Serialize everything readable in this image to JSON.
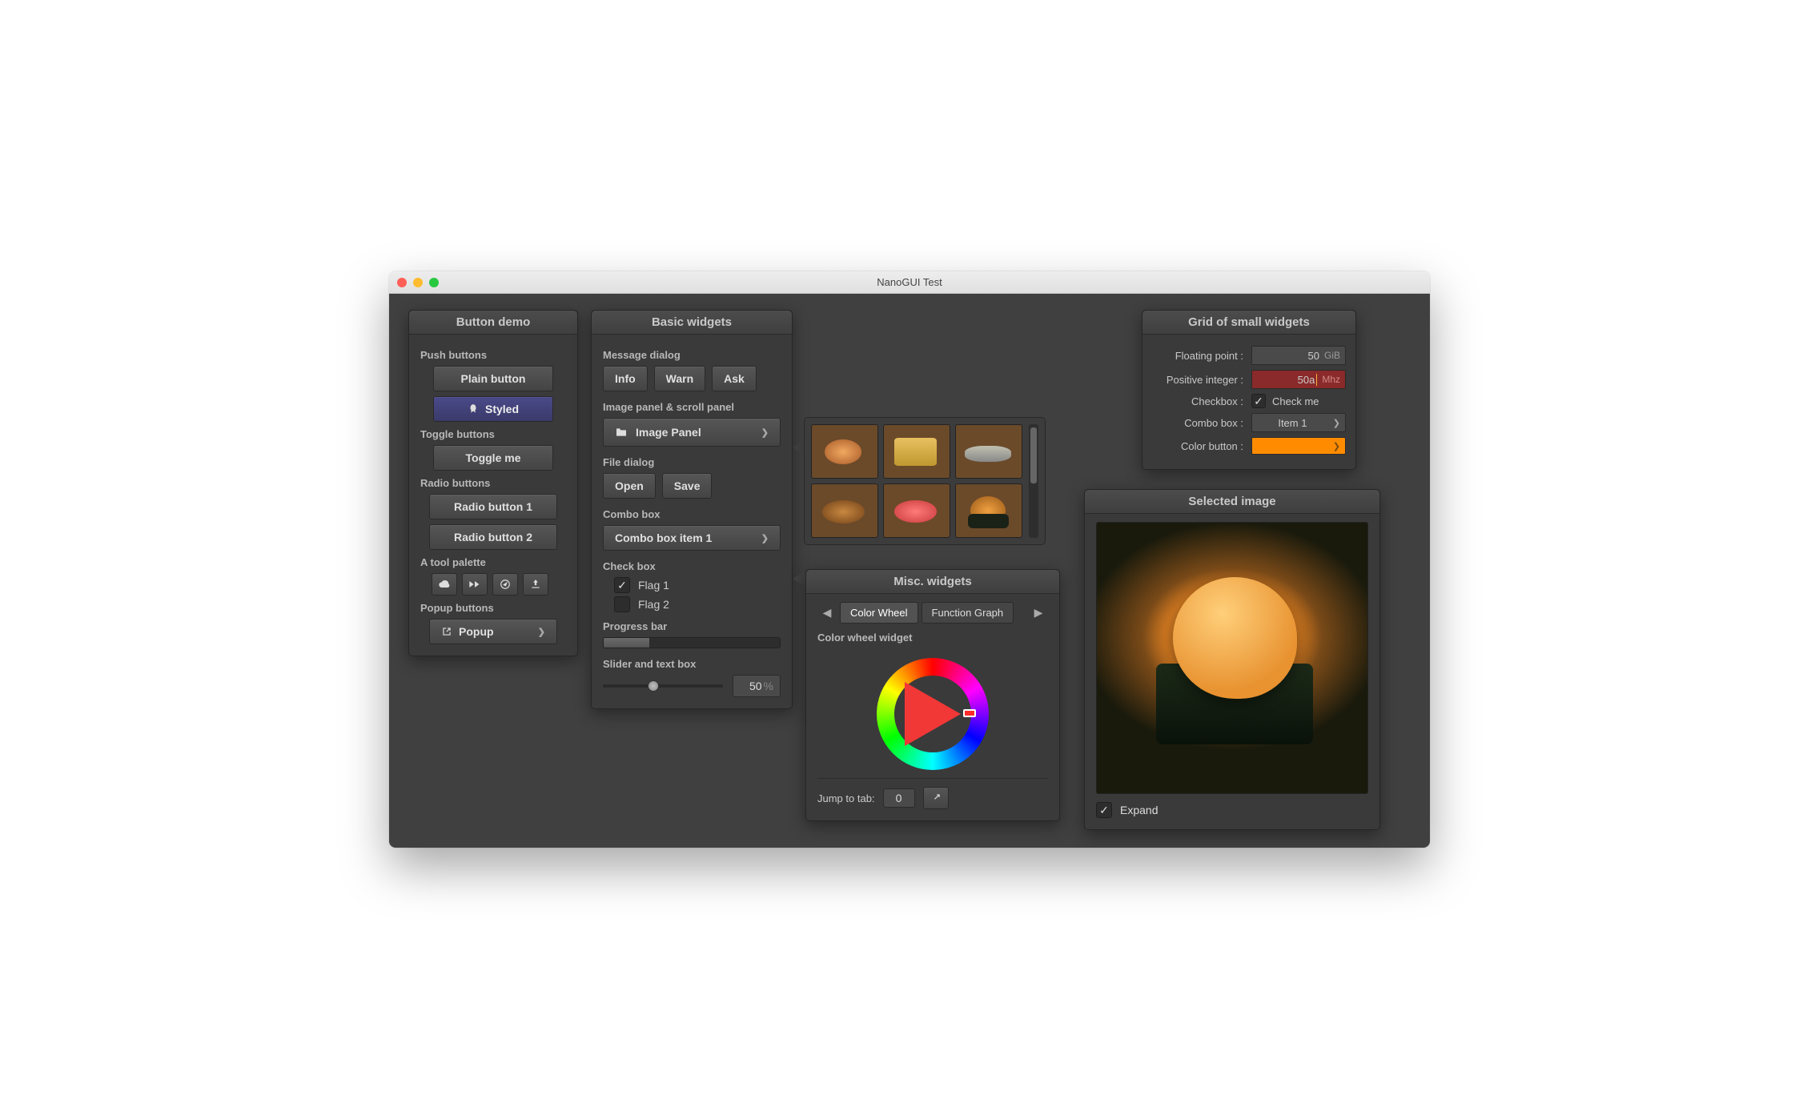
{
  "window": {
    "title": "NanoGUI Test"
  },
  "button_demo": {
    "title": "Button demo",
    "sections": {
      "push": "Push buttons",
      "toggle": "Toggle buttons",
      "radio": "Radio buttons",
      "tool": "A tool palette",
      "popup": "Popup buttons"
    },
    "plain": "Plain button",
    "styled": "Styled",
    "toggle": "Toggle me",
    "radio1": "Radio button 1",
    "radio2": "Radio button 2",
    "popup": "Popup"
  },
  "basic_widgets": {
    "title": "Basic widgets",
    "message_dialog_label": "Message dialog",
    "info": "Info",
    "warn": "Warn",
    "ask": "Ask",
    "image_panel_label": "Image panel & scroll panel",
    "image_panel_btn": "Image Panel",
    "file_dialog_label": "File dialog",
    "open": "Open",
    "save": "Save",
    "combo_label": "Combo box",
    "combo_value": "Combo box item 1",
    "checkbox_label": "Check box",
    "flag1": "Flag 1",
    "flag2": "Flag 2",
    "progress_label": "Progress bar",
    "progress_value": 26,
    "slider_label": "Slider and text box",
    "slider_value": 50,
    "slider_text": "50",
    "slider_unit": "%"
  },
  "misc": {
    "title": "Misc. widgets",
    "tab1": "Color Wheel",
    "tab2": "Function Graph",
    "section": "Color wheel widget",
    "jump_label": "Jump to tab:",
    "jump_value": "0"
  },
  "grid": {
    "title": "Grid of small widgets",
    "float_label": "Floating point :",
    "float_value": "50",
    "float_unit": "GiB",
    "int_label": "Positive integer :",
    "int_value": "50a",
    "int_unit": "Mhz",
    "checkbox_label": "Checkbox :",
    "checkbox_text": "Check me",
    "checkbox_checked": true,
    "combo_label": "Combo box :",
    "combo_value": "Item 1",
    "color_label": "Color button :",
    "color_value": "#ff8c00"
  },
  "selected": {
    "title": "Selected image",
    "expand": "Expand",
    "expand_checked": true
  }
}
